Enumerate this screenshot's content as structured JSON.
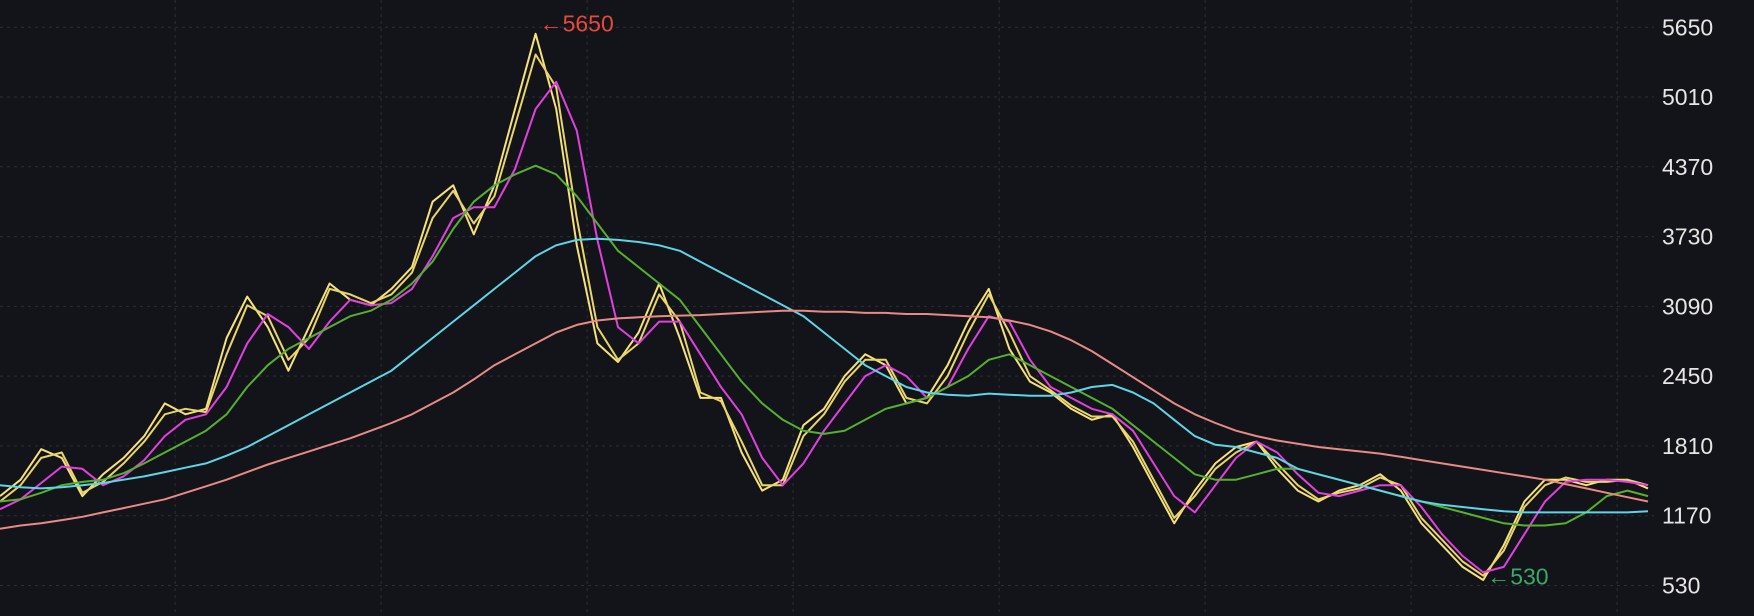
{
  "chart_data": {
    "type": "line",
    "title": "",
    "xlabel": "",
    "ylabel": "",
    "ylim": [
      250,
      5900
    ],
    "y_ticks": [
      "5650",
      "5010",
      "4370",
      "3730",
      "3090",
      "2450",
      "1810",
      "1170",
      "530"
    ],
    "y_tick_values": [
      5650,
      5010,
      4370,
      3730,
      3090,
      2450,
      1810,
      1170,
      530
    ],
    "grid": true,
    "background": "#131419",
    "x": [
      0,
      1,
      2,
      3,
      4,
      5,
      6,
      7,
      8,
      9,
      10,
      11,
      12,
      13,
      14,
      15,
      16,
      17,
      18,
      19,
      20,
      21,
      22,
      23,
      24,
      25,
      26,
      27,
      28,
      29,
      30,
      31,
      32,
      33,
      34,
      35,
      36,
      37,
      38,
      39,
      40,
      41,
      42,
      43,
      44,
      45,
      46,
      47,
      48,
      49,
      50,
      51,
      52,
      53,
      54,
      55,
      56,
      57,
      58,
      59,
      60,
      61,
      62,
      63,
      64,
      65,
      66,
      67,
      68,
      69,
      70,
      71,
      72,
      73,
      74,
      75,
      76,
      77,
      78,
      79,
      80
    ],
    "series": [
      {
        "color": "#f6e27a",
        "values": [
          1350,
          1500,
          1780,
          1700,
          1350,
          1550,
          1700,
          1900,
          2200,
          2100,
          2150,
          2800,
          3180,
          2900,
          2500,
          2900,
          3300,
          3150,
          3100,
          3250,
          3450,
          4050,
          4200,
          3750,
          4200,
          4900,
          5590,
          4900,
          3650,
          2750,
          2580,
          2850,
          3300,
          2800,
          2250,
          2250,
          1750,
          1400,
          1500,
          2000,
          2150,
          2450,
          2650,
          2550,
          2200,
          2250,
          2550,
          2950,
          3250,
          2700,
          2400,
          2300,
          2150,
          2050,
          2100,
          1800,
          1450,
          1100,
          1400,
          1650,
          1800,
          1850,
          1600,
          1400,
          1300,
          1400,
          1450,
          1550,
          1400,
          1100,
          900,
          700,
          580,
          900,
          1300,
          1500,
          1500,
          1450,
          1500,
          1500,
          1420
        ]
      },
      {
        "color": "#e8d46a",
        "values": [
          1300,
          1450,
          1700,
          1750,
          1380,
          1480,
          1650,
          1850,
          2100,
          2150,
          2120,
          2650,
          3100,
          3000,
          2600,
          2800,
          3250,
          3200,
          3120,
          3200,
          3400,
          3900,
          4150,
          3850,
          4100,
          4750,
          5400,
          5100,
          3900,
          2900,
          2600,
          2750,
          3200,
          2950,
          2300,
          2220,
          1850,
          1450,
          1450,
          1900,
          2100,
          2400,
          2600,
          2600,
          2250,
          2200,
          2450,
          2850,
          3200,
          2850,
          2450,
          2320,
          2180,
          2080,
          2080,
          1850,
          1500,
          1150,
          1350,
          1600,
          1750,
          1850,
          1650,
          1450,
          1320,
          1380,
          1420,
          1520,
          1450,
          1150,
          950,
          750,
          620,
          850,
          1250,
          1450,
          1520,
          1480,
          1480,
          1500,
          1450
        ]
      },
      {
        "color": "#e040e0",
        "values": [
          1230,
          1320,
          1470,
          1620,
          1600,
          1450,
          1530,
          1680,
          1900,
          2050,
          2100,
          2350,
          2750,
          3020,
          2900,
          2700,
          2950,
          3150,
          3100,
          3120,
          3250,
          3550,
          3900,
          4000,
          4000,
          4350,
          4900,
          5150,
          4700,
          3700,
          2900,
          2750,
          2950,
          2950,
          2650,
          2350,
          2100,
          1700,
          1450,
          1650,
          1950,
          2200,
          2450,
          2550,
          2450,
          2250,
          2350,
          2700,
          3000,
          2950,
          2600,
          2350,
          2250,
          2150,
          2100,
          1950,
          1650,
          1350,
          1200,
          1450,
          1700,
          1850,
          1750,
          1550,
          1380,
          1350,
          1400,
          1450,
          1450,
          1250,
          1000,
          800,
          650,
          700,
          1000,
          1300,
          1480,
          1500,
          1500,
          1480,
          1450
        ]
      },
      {
        "color": "#55b030",
        "values": [
          1300,
          1320,
          1380,
          1450,
          1480,
          1500,
          1560,
          1650,
          1750,
          1850,
          1950,
          2100,
          2350,
          2550,
          2700,
          2800,
          2900,
          3000,
          3050,
          3150,
          3300,
          3500,
          3800,
          4050,
          4200,
          4300,
          4380,
          4300,
          4100,
          3850,
          3600,
          3450,
          3300,
          3150,
          2900,
          2650,
          2400,
          2200,
          2050,
          1950,
          1920,
          1950,
          2050,
          2150,
          2200,
          2250,
          2350,
          2450,
          2600,
          2650,
          2550,
          2450,
          2350,
          2250,
          2150,
          2000,
          1850,
          1700,
          1550,
          1500,
          1500,
          1550,
          1600,
          1600,
          1550,
          1500,
          1450,
          1400,
          1350,
          1300,
          1250,
          1200,
          1150,
          1100,
          1080,
          1080,
          1100,
          1200,
          1350,
          1400,
          1350
        ]
      },
      {
        "color": "#5ed4e6",
        "values": [
          1450,
          1430,
          1420,
          1430,
          1450,
          1470,
          1500,
          1530,
          1570,
          1610,
          1650,
          1720,
          1800,
          1900,
          2000,
          2100,
          2200,
          2300,
          2400,
          2500,
          2650,
          2800,
          2950,
          3100,
          3250,
          3400,
          3550,
          3650,
          3700,
          3710,
          3700,
          3680,
          3650,
          3600,
          3500,
          3400,
          3300,
          3200,
          3100,
          3000,
          2850,
          2700,
          2550,
          2450,
          2350,
          2300,
          2280,
          2270,
          2290,
          2280,
          2270,
          2270,
          2300,
          2350,
          2370,
          2300,
          2200,
          2050,
          1900,
          1820,
          1800,
          1750,
          1700,
          1600,
          1550,
          1500,
          1450,
          1400,
          1350,
          1300,
          1270,
          1250,
          1230,
          1210,
          1200,
          1200,
          1200,
          1200,
          1200,
          1200,
          1210
        ]
      },
      {
        "color": "#e88a86",
        "values": [
          1050,
          1080,
          1100,
          1130,
          1160,
          1200,
          1240,
          1280,
          1320,
          1380,
          1440,
          1500,
          1570,
          1640,
          1700,
          1760,
          1820,
          1880,
          1950,
          2020,
          2100,
          2200,
          2300,
          2420,
          2550,
          2650,
          2750,
          2850,
          2920,
          2960,
          2980,
          2990,
          3000,
          3005,
          3010,
          3020,
          3030,
          3040,
          3050,
          3050,
          3040,
          3040,
          3030,
          3030,
          3020,
          3020,
          3010,
          3000,
          2990,
          2960,
          2920,
          2860,
          2780,
          2680,
          2560,
          2440,
          2320,
          2200,
          2100,
          2020,
          1950,
          1900,
          1860,
          1830,
          1800,
          1780,
          1760,
          1740,
          1710,
          1680,
          1650,
          1620,
          1590,
          1560,
          1530,
          1500,
          1460,
          1420,
          1380,
          1340,
          1300
        ]
      }
    ],
    "annotations": [
      {
        "text": "←5650",
        "x": 26,
        "y": 5650,
        "color": "#e8483c"
      },
      {
        "text": "←530",
        "x": 72,
        "y": 530,
        "color": "#3aa86b"
      }
    ]
  }
}
